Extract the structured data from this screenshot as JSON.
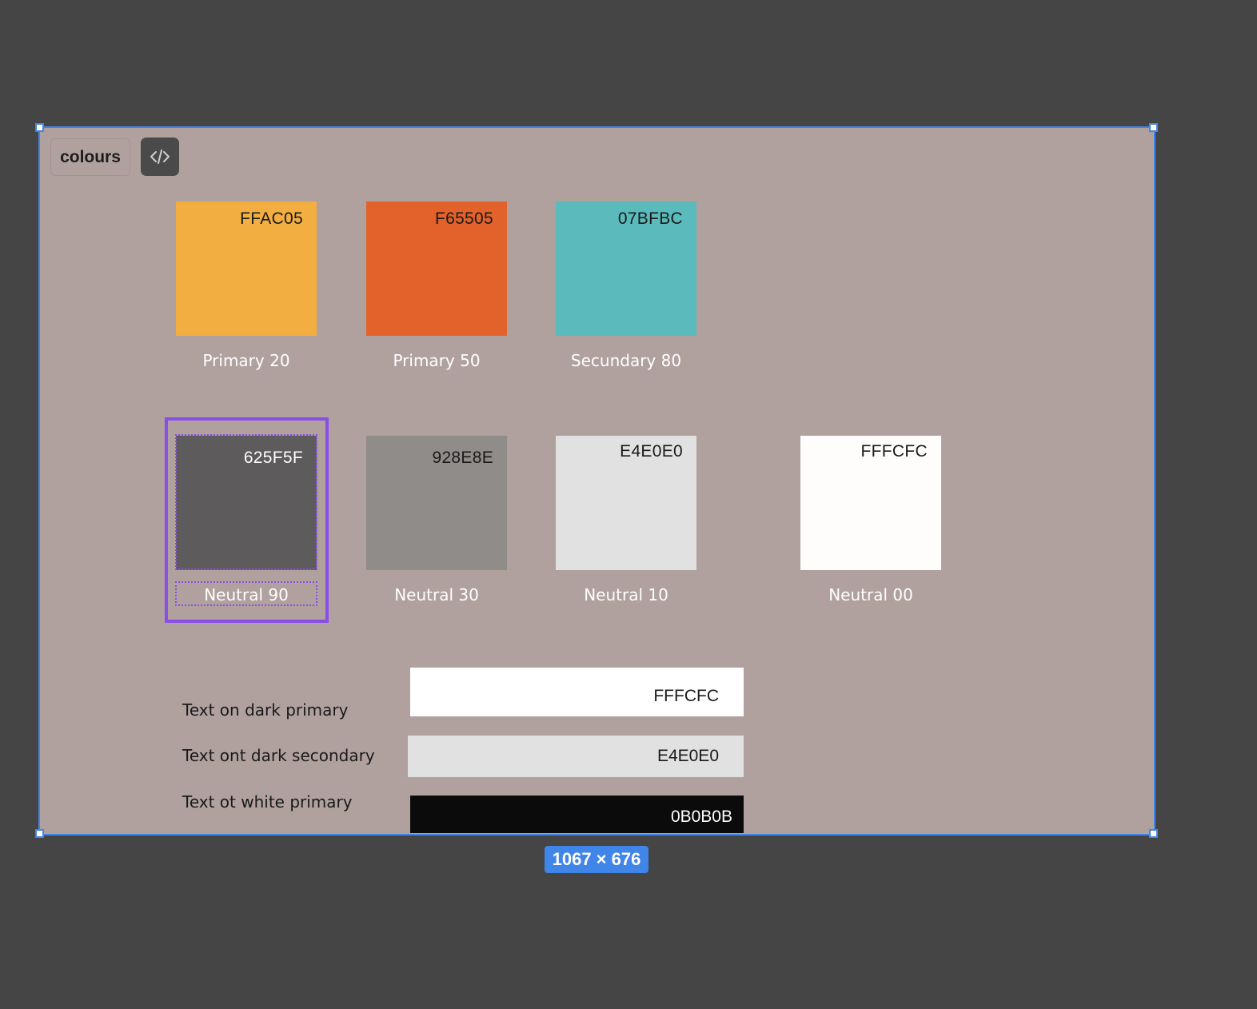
{
  "frame": {
    "label": "colours",
    "code_icon": "code-brackets-icon",
    "size_badge": "1067 × 676"
  },
  "swatches": [
    {
      "hex": "FFAC05",
      "name": "Primary 20",
      "color": "#f2ae40"
    },
    {
      "hex": "F65505",
      "name": "Primary 50",
      "color": "#e3622b"
    },
    {
      "hex": "07BFBC",
      "name": "Secundary 80",
      "color": "#5bbabb"
    },
    {
      "hex": "625F5F",
      "name": "Neutral 90",
      "color": "#5e5b5c"
    },
    {
      "hex": "928E8E",
      "name": "Neutral 30",
      "color": "#8f8c8a"
    },
    {
      "hex": "E4E0E0",
      "name": "Neutral 10",
      "color": "#e1e1e1"
    },
    {
      "hex": "FFFCFC",
      "name": "Neutral 00",
      "color": "#fffdfc"
    }
  ],
  "text_colors": [
    {
      "label": "Text on dark primary",
      "hex": "FFFCFC",
      "color": "#ffffff"
    },
    {
      "label": "Text ont dark secondary",
      "hex": "E4E0E0",
      "color": "#e1e1e1"
    },
    {
      "label": "Text ot white primary",
      "hex": "0B0B0B",
      "color": "#0b0b0b"
    }
  ]
}
